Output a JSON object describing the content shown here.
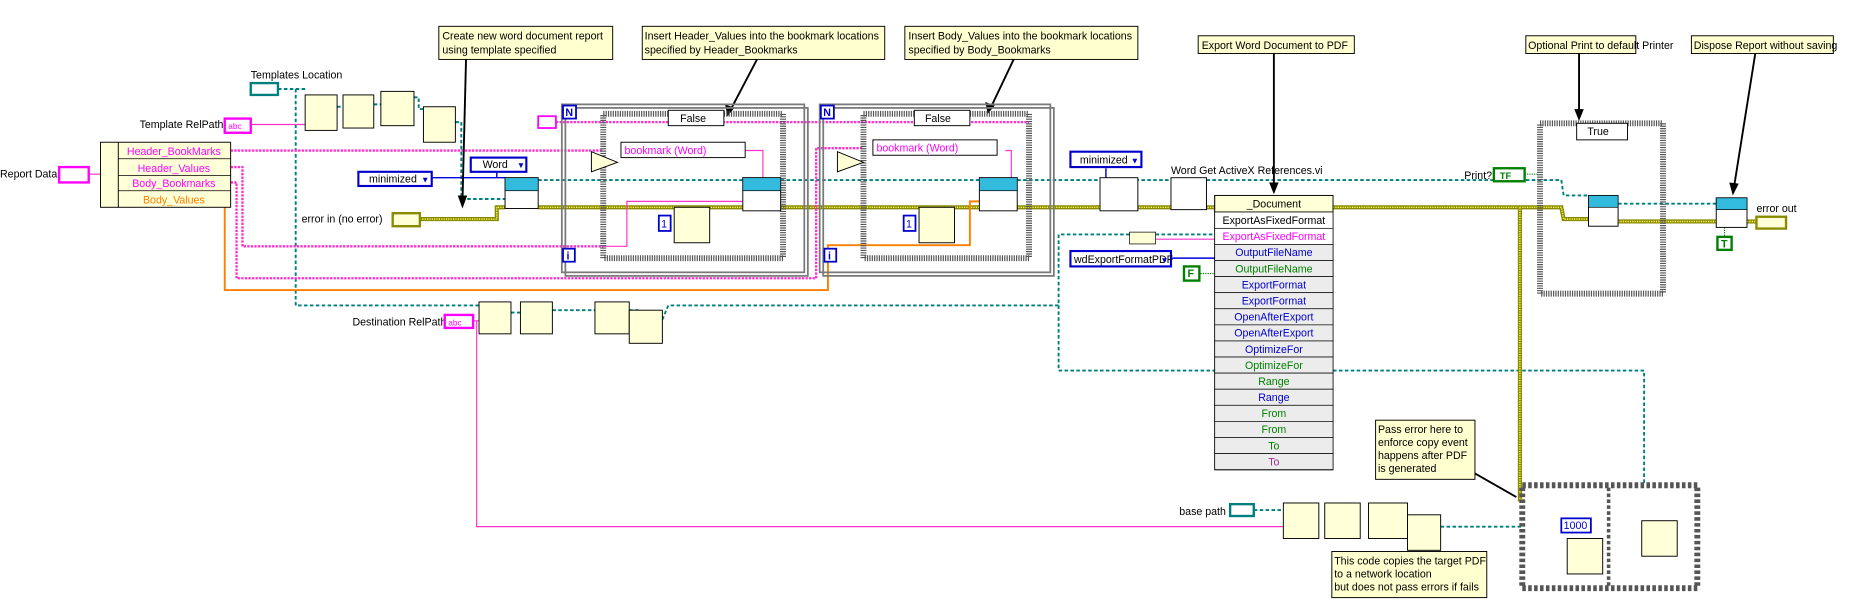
{
  "comments": {
    "create_report": [
      "Create new word document report",
      "using template specified"
    ],
    "insert_header": [
      "Insert Header_Values into the bookmark locations",
      "specified by Header_Bookmarks"
    ],
    "insert_body": [
      "Insert Body_Values into the bookmark locations",
      "specified by Body_Bookmarks"
    ],
    "export_pdf": [
      "Export Word Document to PDF"
    ],
    "optional_print": [
      "Optional Print to default Printer"
    ],
    "dispose": [
      "Dispose Report without saving"
    ],
    "pass_error": [
      "Pass error here to",
      "enforce copy event",
      "happens after PDF",
      "is generated"
    ],
    "copy_code": [
      "This code copies the target PDF",
      "to a network location",
      "but does not pass errors if fails"
    ]
  },
  "labels": {
    "report_data": "Report Data",
    "templates_location": "Templates Location",
    "template_relpath": "Template RelPath",
    "error_in": "error in (no error)",
    "destination_relpath": "Destination RelPath",
    "base_path": "base path",
    "print": "Print?",
    "error_out": "error out",
    "word_get_activex": "Word Get ActiveX References.vi"
  },
  "unbundle": {
    "fields": [
      {
        "name": "Header_BookMarks",
        "color": "#ff00ff"
      },
      {
        "name": "Header_Values",
        "color": "#ff00ff"
      },
      {
        "name": "Body_Bookmarks",
        "color": "#ff00ff"
      },
      {
        "name": "Body_Values",
        "color": "#ff8000"
      }
    ]
  },
  "constants": {
    "word_ring": "Word",
    "minimized_1": "minimized",
    "minimized_2": "minimized",
    "export_format": "wdExportFormatPDF",
    "false_const": "F",
    "true_const": "T",
    "timer_1": "1",
    "timer_2": "1",
    "timer_3": "1000",
    "abc": "abc",
    "tf": "TF"
  },
  "loops": {
    "loop1": {
      "count": "N",
      "index": "i",
      "case_selector": "False",
      "bookmark_label": "bookmark (Word)"
    },
    "loop2": {
      "count": "N",
      "index": "i",
      "case_selector": "False",
      "bookmark_label": "bookmark (Word)"
    },
    "print_case": {
      "case_selector": "True"
    }
  },
  "property_node": {
    "class": "_Document",
    "method": "ExportAsFixedFormat",
    "rows": [
      {
        "name": "ExportAsFixedFormat",
        "color": "#ff00ff"
      },
      {
        "name": "OutputFileName",
        "color": "#0000cc"
      },
      {
        "name": "OutputFileName",
        "color": "#008000"
      },
      {
        "name": "ExportFormat",
        "color": "#0000cc"
      },
      {
        "name": "ExportFormat",
        "color": "#0000cc"
      },
      {
        "name": "OpenAfterExport",
        "color": "#0000cc"
      },
      {
        "name": "OpenAfterExport",
        "color": "#0000cc"
      },
      {
        "name": "OptimizeFor",
        "color": "#0000cc"
      },
      {
        "name": "OptimizeFor",
        "color": "#008000"
      },
      {
        "name": "Range",
        "color": "#008000"
      },
      {
        "name": "Range",
        "color": "#0000cc"
      },
      {
        "name": "From",
        "color": "#008000"
      },
      {
        "name": "From",
        "color": "#008000"
      },
      {
        "name": "To",
        "color": "#008000"
      },
      {
        "name": "To",
        "color": "#993399"
      }
    ]
  },
  "colors": {
    "string_wire": "#ff33cc",
    "refnum_wire": "#007f7f",
    "error_wire": "#8a8a00",
    "numeric": "#0000cc",
    "boolean": "#007f00",
    "comment_bg": "#ffffd0"
  }
}
